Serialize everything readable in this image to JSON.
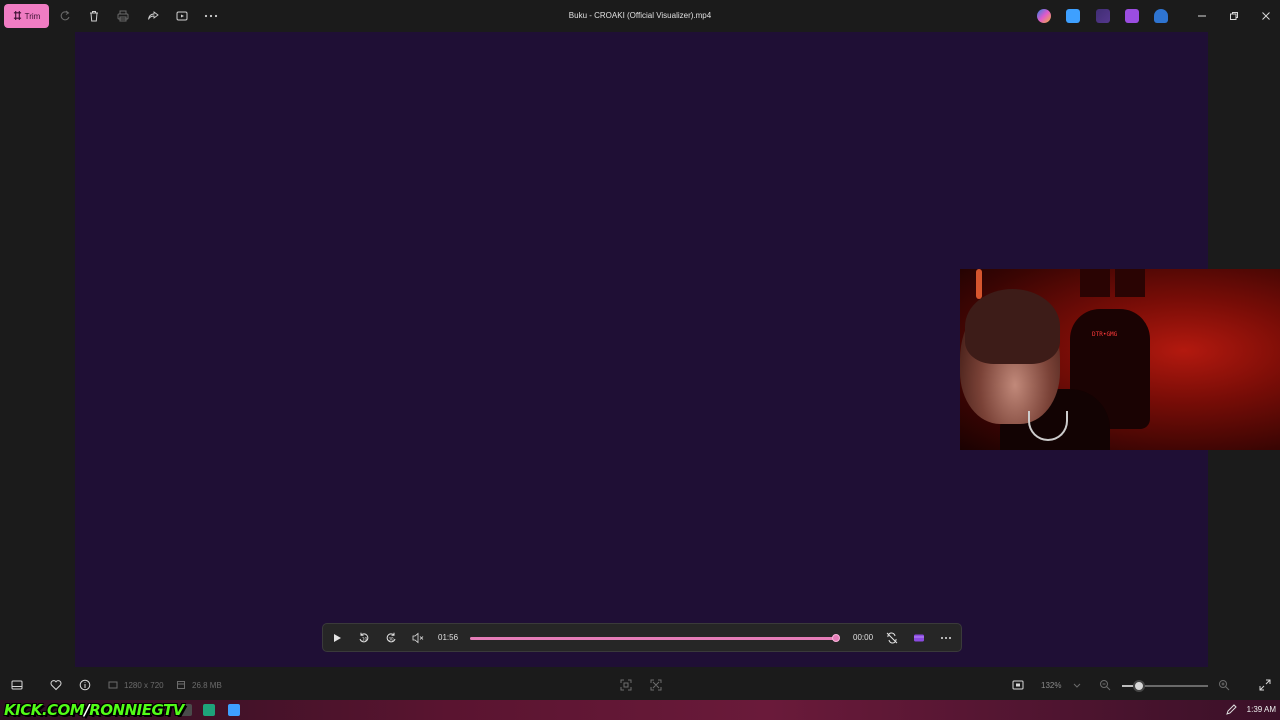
{
  "window": {
    "title": "Buku - CROAKI (Official Visualizer).mp4"
  },
  "toolbar": {
    "trim_label": "Trim",
    "icons": [
      "rotate-icon",
      "delete-icon",
      "print-icon",
      "share-icon",
      "slideshow-icon",
      "more-icon"
    ]
  },
  "extensions": {
    "icons": [
      "copilot-icon",
      "photos-icon",
      "clipchamp-icon",
      "video-editor-icon",
      "onedrive-icon"
    ],
    "colors": [
      "#2b7fe0",
      "#3ea0ff",
      "#7b4ad8",
      "#9b4de0",
      "#2e74d1"
    ]
  },
  "player": {
    "play_label": "Play",
    "rewind_label": "10",
    "forward_label": "30",
    "elapsed": "01:56",
    "remaining": "00:00",
    "progress": 1.0,
    "accent": "#e57db8"
  },
  "status": {
    "dimensions": "1280 x 720",
    "file_size": "26.8 MB",
    "zoom": "132%",
    "zoom_level": 0.2
  },
  "overlay": {
    "chair_text": "DTR•GMG"
  },
  "taskbar": {
    "kick_main": "KICK.COM",
    "kick_slash": "/",
    "kick_user": "RONNIEGTV",
    "clock": "1:39 AM"
  }
}
